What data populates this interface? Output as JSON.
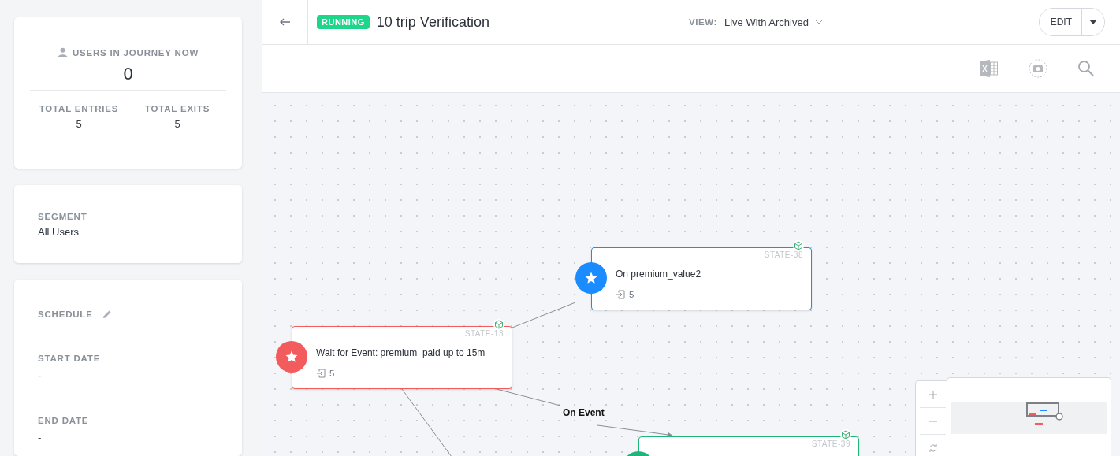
{
  "stats": {
    "title": "USERS IN JOURNEY NOW",
    "value": "0",
    "entries_label": "TOTAL ENTRIES",
    "entries": "5",
    "exits_label": "TOTAL EXITS",
    "exits": "5"
  },
  "segment": {
    "label": "SEGMENT",
    "value": "All Users"
  },
  "schedule": {
    "title": "SCHEDULE",
    "fields": [
      {
        "label": "START DATE",
        "value": "-"
      },
      {
        "label": "END DATE",
        "value": "-"
      }
    ]
  },
  "header": {
    "status": "RUNNING",
    "title": "10 trip Verification",
    "view_label": "VIEW:",
    "view_value": "Live With Archived",
    "edit": "EDIT"
  },
  "nodes": [
    {
      "state": "STATE-38",
      "title": "On premium_value2",
      "count": "5",
      "color": "#1a8cff"
    },
    {
      "state": "STATE-13",
      "title": "Wait for Event: premium_paid up to 15m",
      "count": "5",
      "color": "#f25c5c"
    },
    {
      "state": "STATE-39",
      "color": "#1fb57a"
    }
  ],
  "edge_label": "On Event"
}
